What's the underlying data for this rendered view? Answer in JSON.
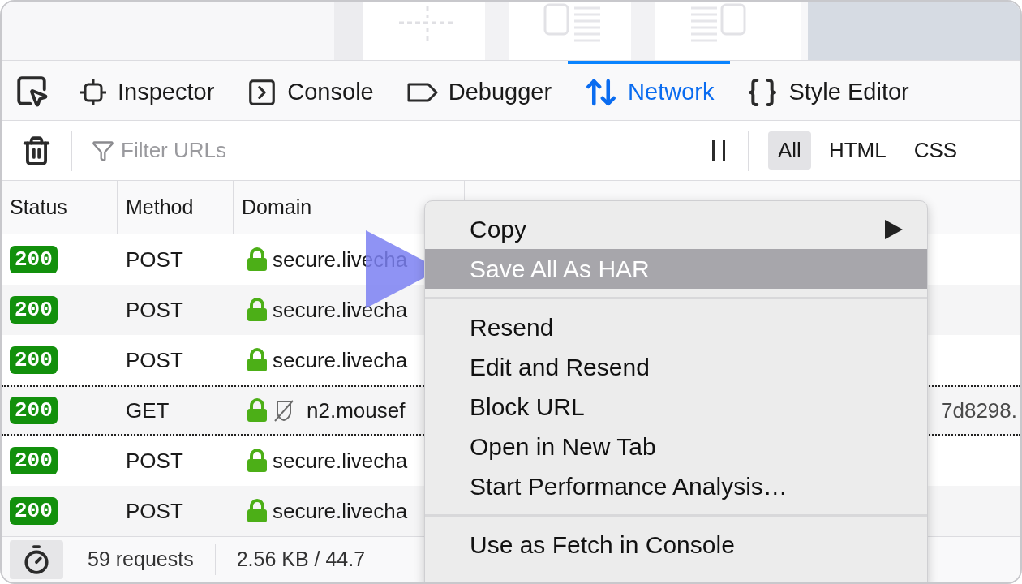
{
  "toolbar": {
    "tabs": [
      {
        "label": "Inspector",
        "kind": "inspector",
        "selected": false
      },
      {
        "label": "Console",
        "kind": "console",
        "selected": false
      },
      {
        "label": "Debugger",
        "kind": "debugger",
        "selected": false
      },
      {
        "label": "Network",
        "kind": "network",
        "selected": true
      },
      {
        "label": "Style Editor",
        "kind": "style",
        "selected": false
      }
    ]
  },
  "filter_bar": {
    "search": {
      "placeholder": "Filter URLs"
    },
    "types": [
      {
        "label": "All",
        "selected": true
      },
      {
        "label": "HTML",
        "selected": false
      },
      {
        "label": "CSS",
        "selected": false
      }
    ]
  },
  "table": {
    "columns": [
      "Status",
      "Method",
      "Domain"
    ],
    "rows": [
      {
        "status": "200",
        "method": "POST",
        "domain": "secure.livecha",
        "tracker": false,
        "focused": false
      },
      {
        "status": "200",
        "method": "POST",
        "domain": "secure.livecha",
        "tracker": false,
        "focused": false
      },
      {
        "status": "200",
        "method": "POST",
        "domain": "secure.livecha",
        "tracker": false,
        "focused": false
      },
      {
        "status": "200",
        "method": "GET",
        "domain": "n2.mousef",
        "tracker": true,
        "focused": true,
        "column_4": "7d8298."
      },
      {
        "status": "200",
        "method": "POST",
        "domain": "secure.livecha",
        "tracker": false,
        "focused": false
      },
      {
        "status": "200",
        "method": "POST",
        "domain": "secure.livecha",
        "tracker": false,
        "focused": false
      }
    ]
  },
  "status_bar": {
    "requests": "59 requests",
    "transferred": "2.56 KB / 44.7"
  },
  "context_menu": {
    "items": [
      {
        "kind": "item",
        "label": "Copy",
        "submenu": true,
        "selected": false
      },
      {
        "kind": "item",
        "label": "Save All As HAR",
        "submenu": false,
        "selected": true
      },
      {
        "kind": "separator"
      },
      {
        "kind": "item",
        "label": "Resend",
        "submenu": false,
        "selected": false
      },
      {
        "kind": "item",
        "label": "Edit and Resend",
        "submenu": false,
        "selected": false
      },
      {
        "kind": "item",
        "label": "Block URL",
        "submenu": false,
        "selected": false
      },
      {
        "kind": "item",
        "label": "Open in New Tab",
        "submenu": false,
        "selected": false
      },
      {
        "kind": "item",
        "label": "Start Performance Analysis…",
        "submenu": false,
        "selected": false
      },
      {
        "kind": "separator"
      },
      {
        "kind": "item",
        "label": "Use as Fetch in Console",
        "submenu": false,
        "selected": false
      }
    ]
  }
}
